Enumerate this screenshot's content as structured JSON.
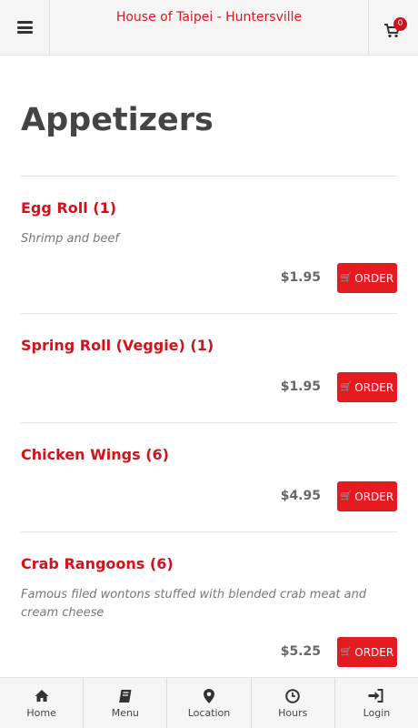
{
  "header": {
    "title": "House of Taipei - Huntersville",
    "cart_count": "0"
  },
  "section": {
    "title": "Appetizers"
  },
  "items": [
    {
      "name": "Egg Roll (1)",
      "description": "Shrimp and beef",
      "price": "$1.95",
      "order_label": "ORDER"
    },
    {
      "name": "Spring Roll (Veggie) (1)",
      "description": "",
      "price": "$1.95",
      "order_label": "ORDER"
    },
    {
      "name": "Chicken Wings (6)",
      "description": "",
      "price": "$4.95",
      "order_label": "ORDER"
    },
    {
      "name": "Crab Rangoons (6)",
      "description": "Famous filed wontons stuffed with blended crab meat and cream cheese",
      "price": "$5.25",
      "order_label": "ORDER"
    }
  ],
  "bottom_nav": [
    {
      "label": "Home",
      "icon": "home-icon"
    },
    {
      "label": "Menu",
      "icon": "book-icon"
    },
    {
      "label": "Location",
      "icon": "map-marker-icon"
    },
    {
      "label": "Hours",
      "icon": "clock-icon"
    },
    {
      "label": "Login",
      "icon": "sign-in-icon"
    }
  ],
  "colors": {
    "accent": "#e61b1f",
    "title_red": "#d3121b",
    "bar_bg": "#f5f5f5"
  }
}
